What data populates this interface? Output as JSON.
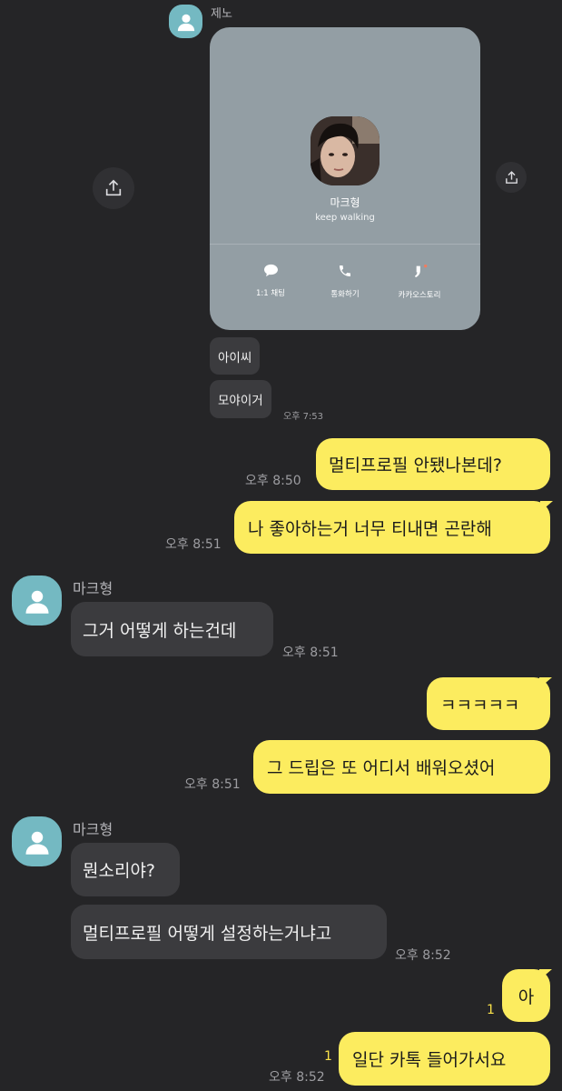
{
  "header": {
    "sender_name": "제노"
  },
  "profile_card": {
    "name": "마크형",
    "status": "keep walking",
    "actions": [
      {
        "label": "1:1 채팅",
        "icon": "chat-bubble-icon"
      },
      {
        "label": "통화하기",
        "icon": "phone-icon"
      },
      {
        "label": "카카오스토리",
        "icon": "kakaostory-icon"
      }
    ]
  },
  "messages": {
    "m1": {
      "text": "아이씨"
    },
    "m2": {
      "text": "모야이거",
      "time": "오후 7:53"
    },
    "m3": {
      "text": "멀티프로필 안됐나본데?",
      "time": "오후 8:50"
    },
    "m4": {
      "text": "나 좋아하는거 너무 티내면 곤란해",
      "time": "오후 8:51"
    },
    "m5": {
      "sender": "마크형",
      "text": "그거 어떻게 하는건데",
      "time": "오후 8:51"
    },
    "m6": {
      "text": "ㅋㅋㅋㅋㅋ"
    },
    "m7": {
      "text": "그 드립은 또 어디서 배워오셨어",
      "time": "오후 8:51"
    },
    "m8": {
      "sender": "마크형",
      "text": "뭔소리야?"
    },
    "m9": {
      "text": "멀티프로필 어떻게 설정하는거냐고",
      "time": "오후 8:52"
    },
    "m10": {
      "text": "아",
      "unread": "1"
    },
    "m11": {
      "text": "일단 카톡 들어가서요",
      "time": "오후 8:52",
      "unread": "1"
    }
  },
  "colors": {
    "background": "#252527",
    "my_bubble": "#fcec5f",
    "other_bubble": "#3b3b3e",
    "avatar": "#74b9c2",
    "card": "#939ea4"
  }
}
